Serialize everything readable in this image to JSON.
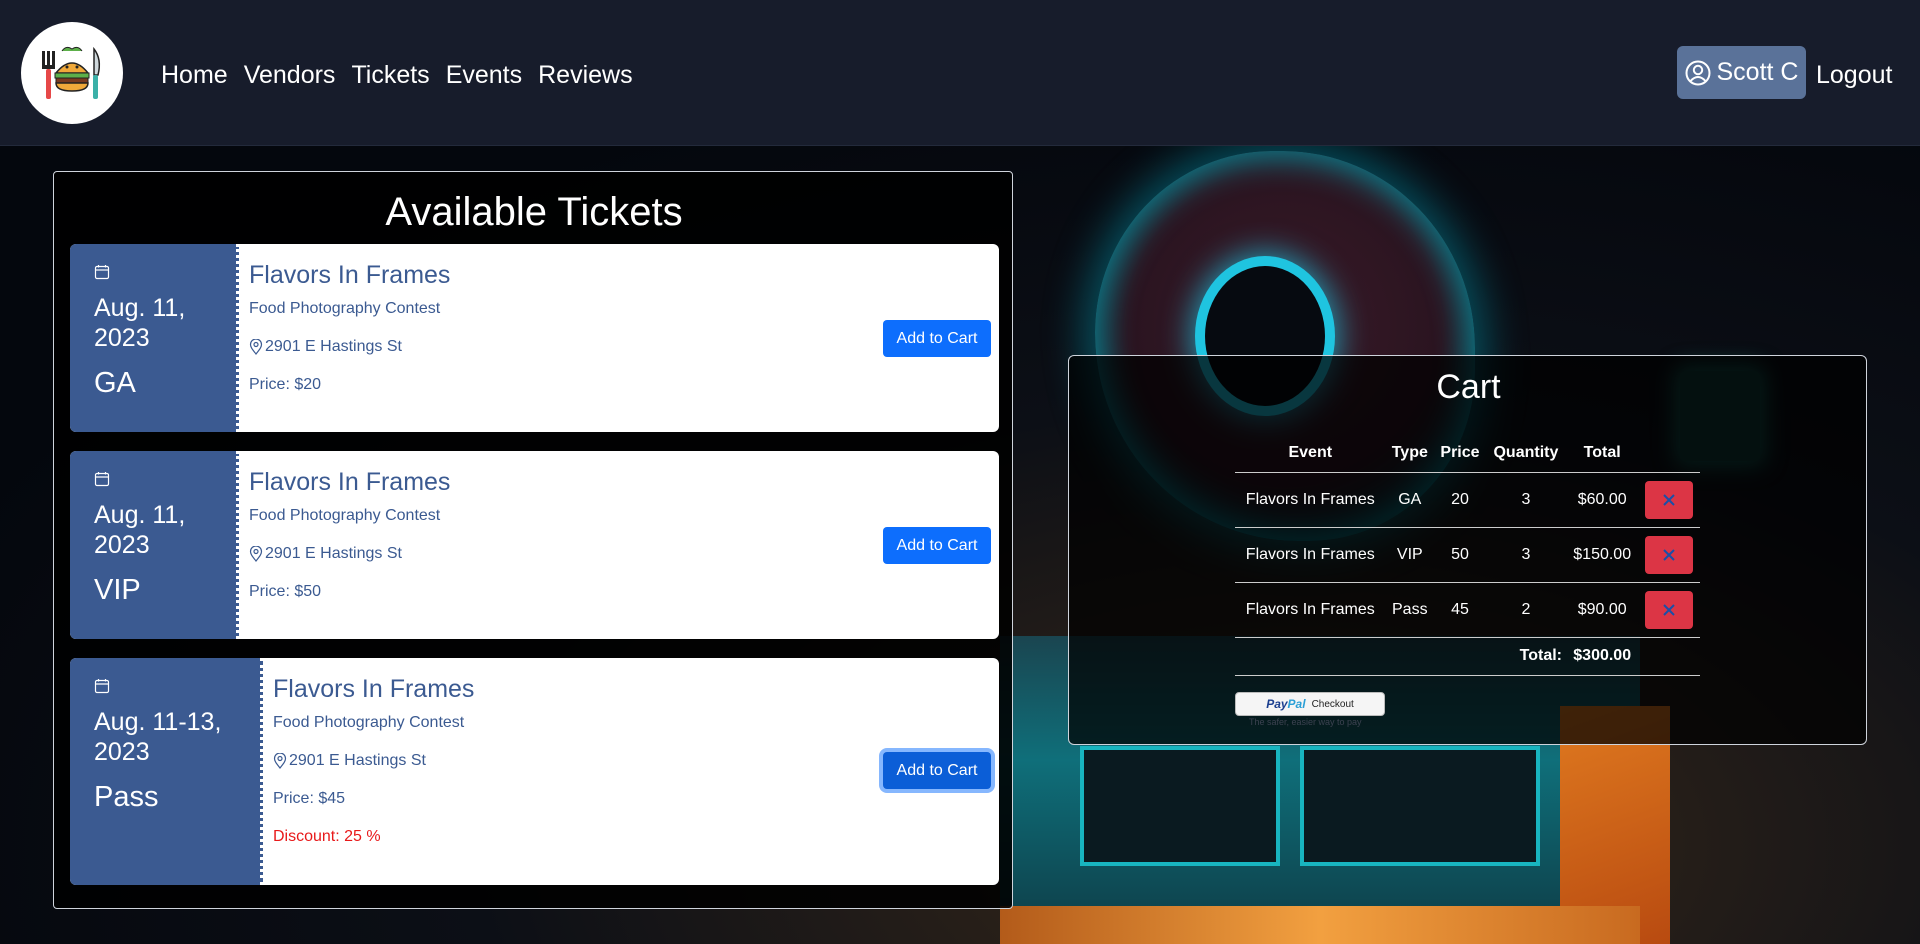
{
  "nav": {
    "links": [
      "Home",
      "Vendors",
      "Tickets",
      "Events",
      "Reviews"
    ],
    "user_name": "Scott C",
    "logout_label": "Logout"
  },
  "tickets": {
    "title": "Available Tickets",
    "add_label": "Add to Cart",
    "items": [
      {
        "date": "Aug. 11, 2023",
        "type": "GA",
        "event": "Flavors In Frames",
        "description": "Food Photography Contest",
        "location": "2901 E Hastings St",
        "price": "Price: $20"
      },
      {
        "date": "Aug. 11, 2023",
        "type": "VIP",
        "event": "Flavors In Frames",
        "description": "Food Photography Contest",
        "location": "2901 E Hastings St",
        "price": "Price: $50"
      },
      {
        "date": "Aug. 11-13, 2023",
        "type": "Pass",
        "event": "Flavors In Frames",
        "description": "Food Photography Contest",
        "location": "2901 E Hastings St",
        "price": "Price: $45",
        "discount": "Discount: 25 %"
      }
    ]
  },
  "cart": {
    "title": "Cart",
    "headers": [
      "Event",
      "Type",
      "Price",
      "Quantity",
      "Total"
    ],
    "rows": [
      {
        "event": "Flavors In Frames",
        "type": "GA",
        "price": "20",
        "quantity": "3",
        "total": "$60.00"
      },
      {
        "event": "Flavors In Frames",
        "type": "VIP",
        "price": "50",
        "quantity": "3",
        "total": "$150.00"
      },
      {
        "event": "Flavors In Frames",
        "type": "Pass",
        "price": "45",
        "quantity": "2",
        "total": "$90.00"
      }
    ],
    "total_label": "Total:",
    "total_value": "$300.00",
    "paypal": {
      "logo_pay": "Pay",
      "logo_pal": "Pal",
      "label": "Checkout",
      "tagline": "The safer, easier way to pay"
    }
  },
  "colors": {
    "navbar": "#171c2b",
    "ticket_stub": "#3b5a91",
    "primary_button": "#0d6efd",
    "delete_button": "#dc3545",
    "user_button": "#5a7299",
    "discount": "#e8191a"
  }
}
